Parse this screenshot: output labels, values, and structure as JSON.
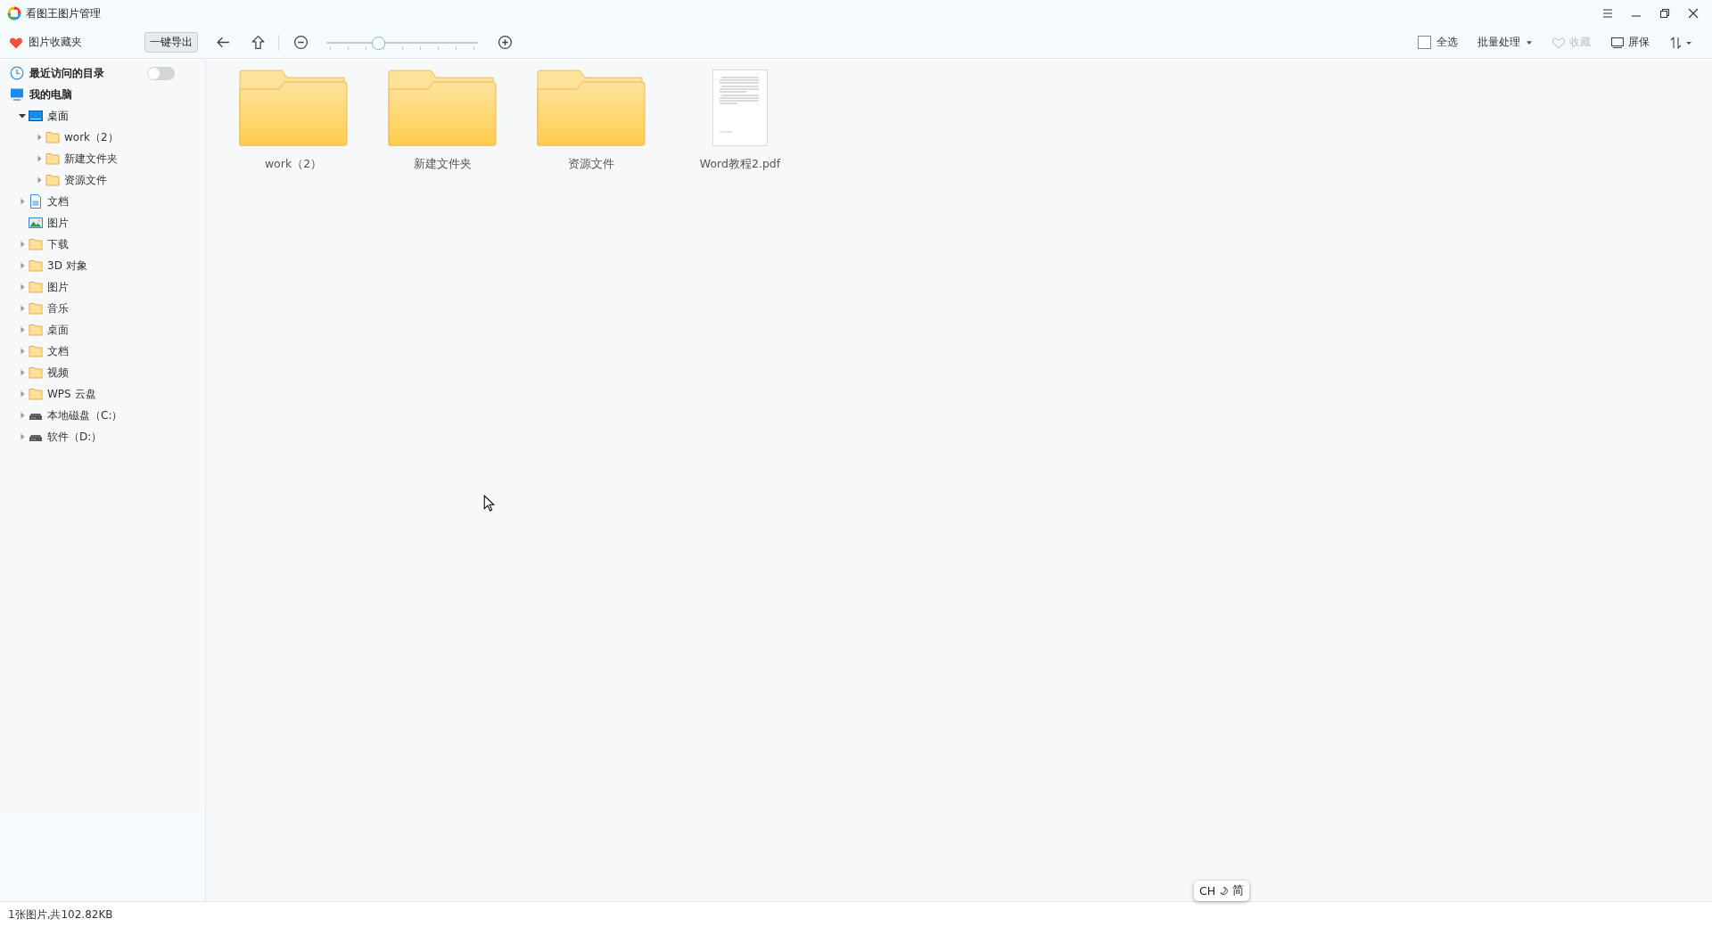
{
  "window": {
    "title": "看图王图片管理"
  },
  "toolbar": {
    "favorites_label": "图片收藏夹",
    "export_button": "一键导出",
    "zoom": {
      "level": 0.34
    },
    "select_all": {
      "label": "全选",
      "checked": false
    },
    "batch": {
      "label": "批量处理"
    },
    "collect": {
      "label": "收藏",
      "disabled": true
    },
    "screensaver": {
      "label": "屏保"
    }
  },
  "sidebar": {
    "recent": {
      "label": "最近访问的目录",
      "on": false
    },
    "computer": {
      "label": "我的电脑"
    },
    "tree": [
      {
        "label": "桌面",
        "kind": "desktop",
        "expandable": true,
        "expanded": true,
        "children": [
          {
            "label": "work（2）",
            "kind": "folder",
            "expandable": true,
            "expanded": false
          },
          {
            "label": "新建文件夹",
            "kind": "folder",
            "expandable": true,
            "expanded": false
          },
          {
            "label": "资源文件",
            "kind": "folder",
            "expandable": true,
            "expanded": false
          }
        ]
      },
      {
        "label": "文档",
        "kind": "document",
        "expandable": true,
        "expanded": false
      },
      {
        "label": "图片",
        "kind": "pictures",
        "expandable": false,
        "expanded": false
      },
      {
        "label": "下载",
        "kind": "folder",
        "expandable": true,
        "expanded": false
      },
      {
        "label": "3D 对象",
        "kind": "folder",
        "expandable": true,
        "expanded": false
      },
      {
        "label": "图片",
        "kind": "folder",
        "expandable": true,
        "expanded": false
      },
      {
        "label": "音乐",
        "kind": "folder",
        "expandable": true,
        "expanded": false
      },
      {
        "label": "桌面",
        "kind": "folder",
        "expandable": true,
        "expanded": false
      },
      {
        "label": "文档",
        "kind": "folder",
        "expandable": true,
        "expanded": false
      },
      {
        "label": "视频",
        "kind": "folder",
        "expandable": true,
        "expanded": false
      },
      {
        "label": "WPS 云盘",
        "kind": "folder",
        "expandable": true,
        "expanded": false
      },
      {
        "label": "本地磁盘（C:）",
        "kind": "drive",
        "expandable": true,
        "expanded": false
      },
      {
        "label": "软件（D:）",
        "kind": "drive",
        "expandable": true,
        "expanded": false
      }
    ]
  },
  "files": [
    {
      "name": "work（2）",
      "kind": "folder"
    },
    {
      "name": "新建文件夹",
      "kind": "folder"
    },
    {
      "name": "资源文件",
      "kind": "folder"
    },
    {
      "name": "Word教程2.pdf",
      "kind": "document"
    }
  ],
  "status_bar": "1张图片,共102.82KB",
  "ime": {
    "language": "CH",
    "mode": "简"
  }
}
